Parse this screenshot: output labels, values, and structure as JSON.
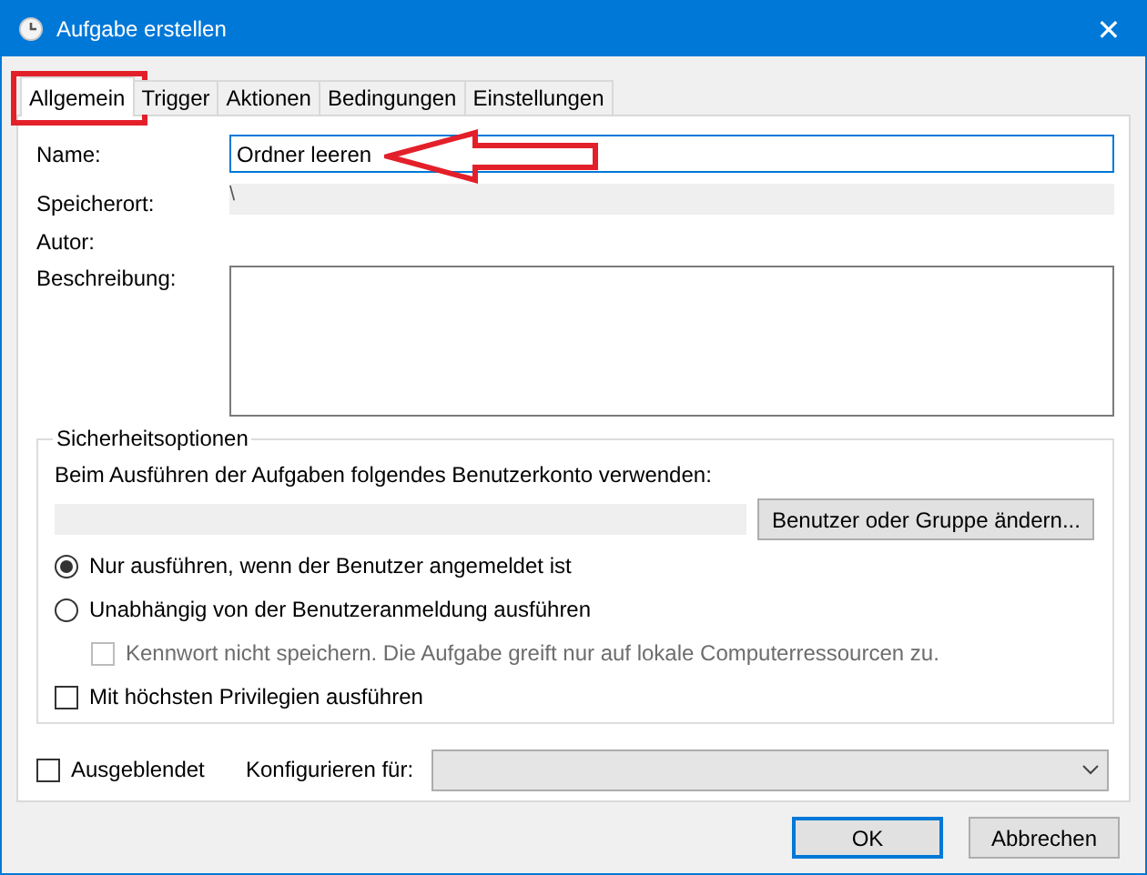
{
  "window": {
    "title": "Aufgabe erstellen",
    "close": "✕"
  },
  "tabs": [
    {
      "label": "Allgemein",
      "selected": true
    },
    {
      "label": "Trigger",
      "selected": false
    },
    {
      "label": "Aktionen",
      "selected": false
    },
    {
      "label": "Bedingungen",
      "selected": false
    },
    {
      "label": "Einstellungen",
      "selected": false
    }
  ],
  "fields": [
    {
      "kind": "input",
      "label": "Name:",
      "value": "Ordner leeren"
    },
    {
      "kind": "readonly",
      "label": "Speicherort:",
      "value": "\\"
    },
    {
      "kind": "plain",
      "label": "Autor:"
    },
    {
      "kind": "textarea",
      "label": "Beschreibung:"
    }
  ],
  "security": {
    "legend": "Sicherheitsoptionen",
    "account_label": "Beim Ausführen der Aufgaben folgendes Benutzerkonto verwenden:",
    "change_button": "Benutzer oder Gruppe ändern...",
    "options": [
      {
        "kind": "radio",
        "label": "Nur ausführen, wenn der Benutzer angemeldet ist",
        "selected": true,
        "disabled": false
      },
      {
        "kind": "radio",
        "label": "Unabhängig von der Benutzeranmeldung ausführen",
        "selected": false,
        "disabled": false
      },
      {
        "kind": "subcheck",
        "label": "Kennwort nicht speichern. Die Aufgabe greift nur auf lokale Computerressourcen zu.",
        "checked": false,
        "disabled": true
      },
      {
        "kind": "check",
        "label": "Mit höchsten Privilegien ausführen",
        "checked": false,
        "disabled": false
      }
    ]
  },
  "hidden": {
    "label": "Ausgeblendet",
    "checked": false
  },
  "configure": {
    "label": "Konfigurieren für:"
  },
  "buttons": [
    {
      "label": "OK",
      "default": true
    },
    {
      "label": "Abbrechen",
      "default": false
    }
  ]
}
